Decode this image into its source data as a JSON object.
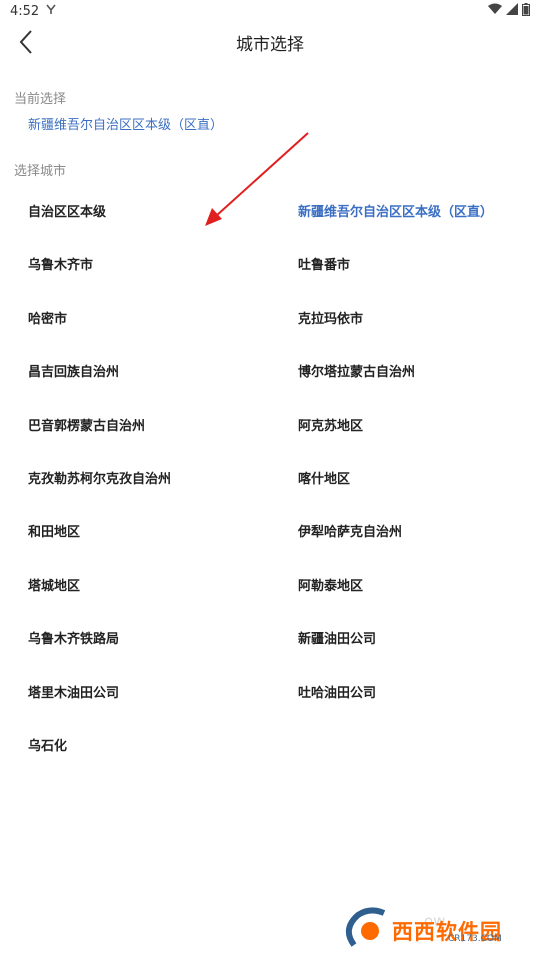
{
  "status_bar": {
    "time": "4:52"
  },
  "header": {
    "title": "城市选择"
  },
  "current_section": {
    "label": "当前选择",
    "value": "新疆维吾尔自治区区本级（区直）"
  },
  "city_section": {
    "label": "选择城市",
    "cities": [
      {
        "name": "自治区区本级",
        "selected": false
      },
      {
        "name": "新疆维吾尔自治区区本级（区直）",
        "selected": true
      },
      {
        "name": "乌鲁木齐市",
        "selected": false
      },
      {
        "name": "吐鲁番市",
        "selected": false
      },
      {
        "name": "哈密市",
        "selected": false
      },
      {
        "name": "克拉玛依市",
        "selected": false
      },
      {
        "name": "昌吉回族自治州",
        "selected": false
      },
      {
        "name": "博尔塔拉蒙古自治州",
        "selected": false
      },
      {
        "name": "巴音郭楞蒙古自治州",
        "selected": false
      },
      {
        "name": "阿克苏地区",
        "selected": false
      },
      {
        "name": "克孜勒苏柯尔克孜自治州",
        "selected": false
      },
      {
        "name": "喀什地区",
        "selected": false
      },
      {
        "name": "和田地区",
        "selected": false
      },
      {
        "name": "伊犁哈萨克自治州",
        "selected": false
      },
      {
        "name": "塔城地区",
        "selected": false
      },
      {
        "name": "阿勒泰地区",
        "selected": false
      },
      {
        "name": "乌鲁木齐铁路局",
        "selected": false
      },
      {
        "name": "新疆油田公司",
        "selected": false
      },
      {
        "name": "塔里木油田公司",
        "selected": false
      },
      {
        "name": "吐哈油田公司",
        "selected": false
      },
      {
        "name": "乌石化",
        "selected": false
      }
    ]
  },
  "watermark": {
    "brand": "西西软件园",
    "url": "CR173.COM"
  },
  "colors": {
    "accent": "#3b6fc4",
    "annotation": "#e02020",
    "muted": "#8a8a8a"
  }
}
